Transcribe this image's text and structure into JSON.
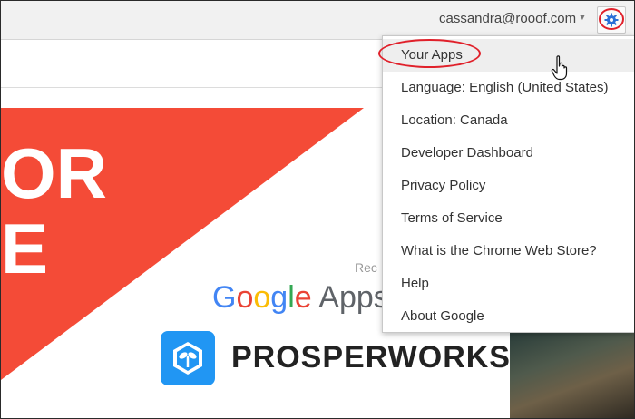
{
  "header": {
    "account_email": "cassandra@rooof.com",
    "caret": "▼",
    "settings_icon": "gear-icon"
  },
  "banner": {
    "big_text_line1": "OR",
    "big_text_line2": "E",
    "recommended_text": "Rec",
    "google_word": [
      "G",
      "o",
      "o",
      "g",
      "l",
      "e"
    ],
    "apps_text": "Apps f",
    "brand_name": "PROSPERWORKS",
    "brand_logo_icon": "sprout-cube-icon",
    "accent_red": "#f44b37",
    "next_arrow": "›"
  },
  "settings_menu": {
    "items": [
      {
        "label": "Your Apps",
        "highlighted": true
      },
      {
        "label": "Language: English (United States)"
      },
      {
        "label": "Location: Canada"
      },
      {
        "label": "Developer Dashboard"
      },
      {
        "label": "Privacy Policy"
      },
      {
        "label": "Terms of Service"
      },
      {
        "label": "What is the Chrome Web Store?"
      },
      {
        "label": "Help"
      },
      {
        "label": "About Google"
      }
    ]
  },
  "annotations": {
    "circle_color": "#e0202a"
  }
}
